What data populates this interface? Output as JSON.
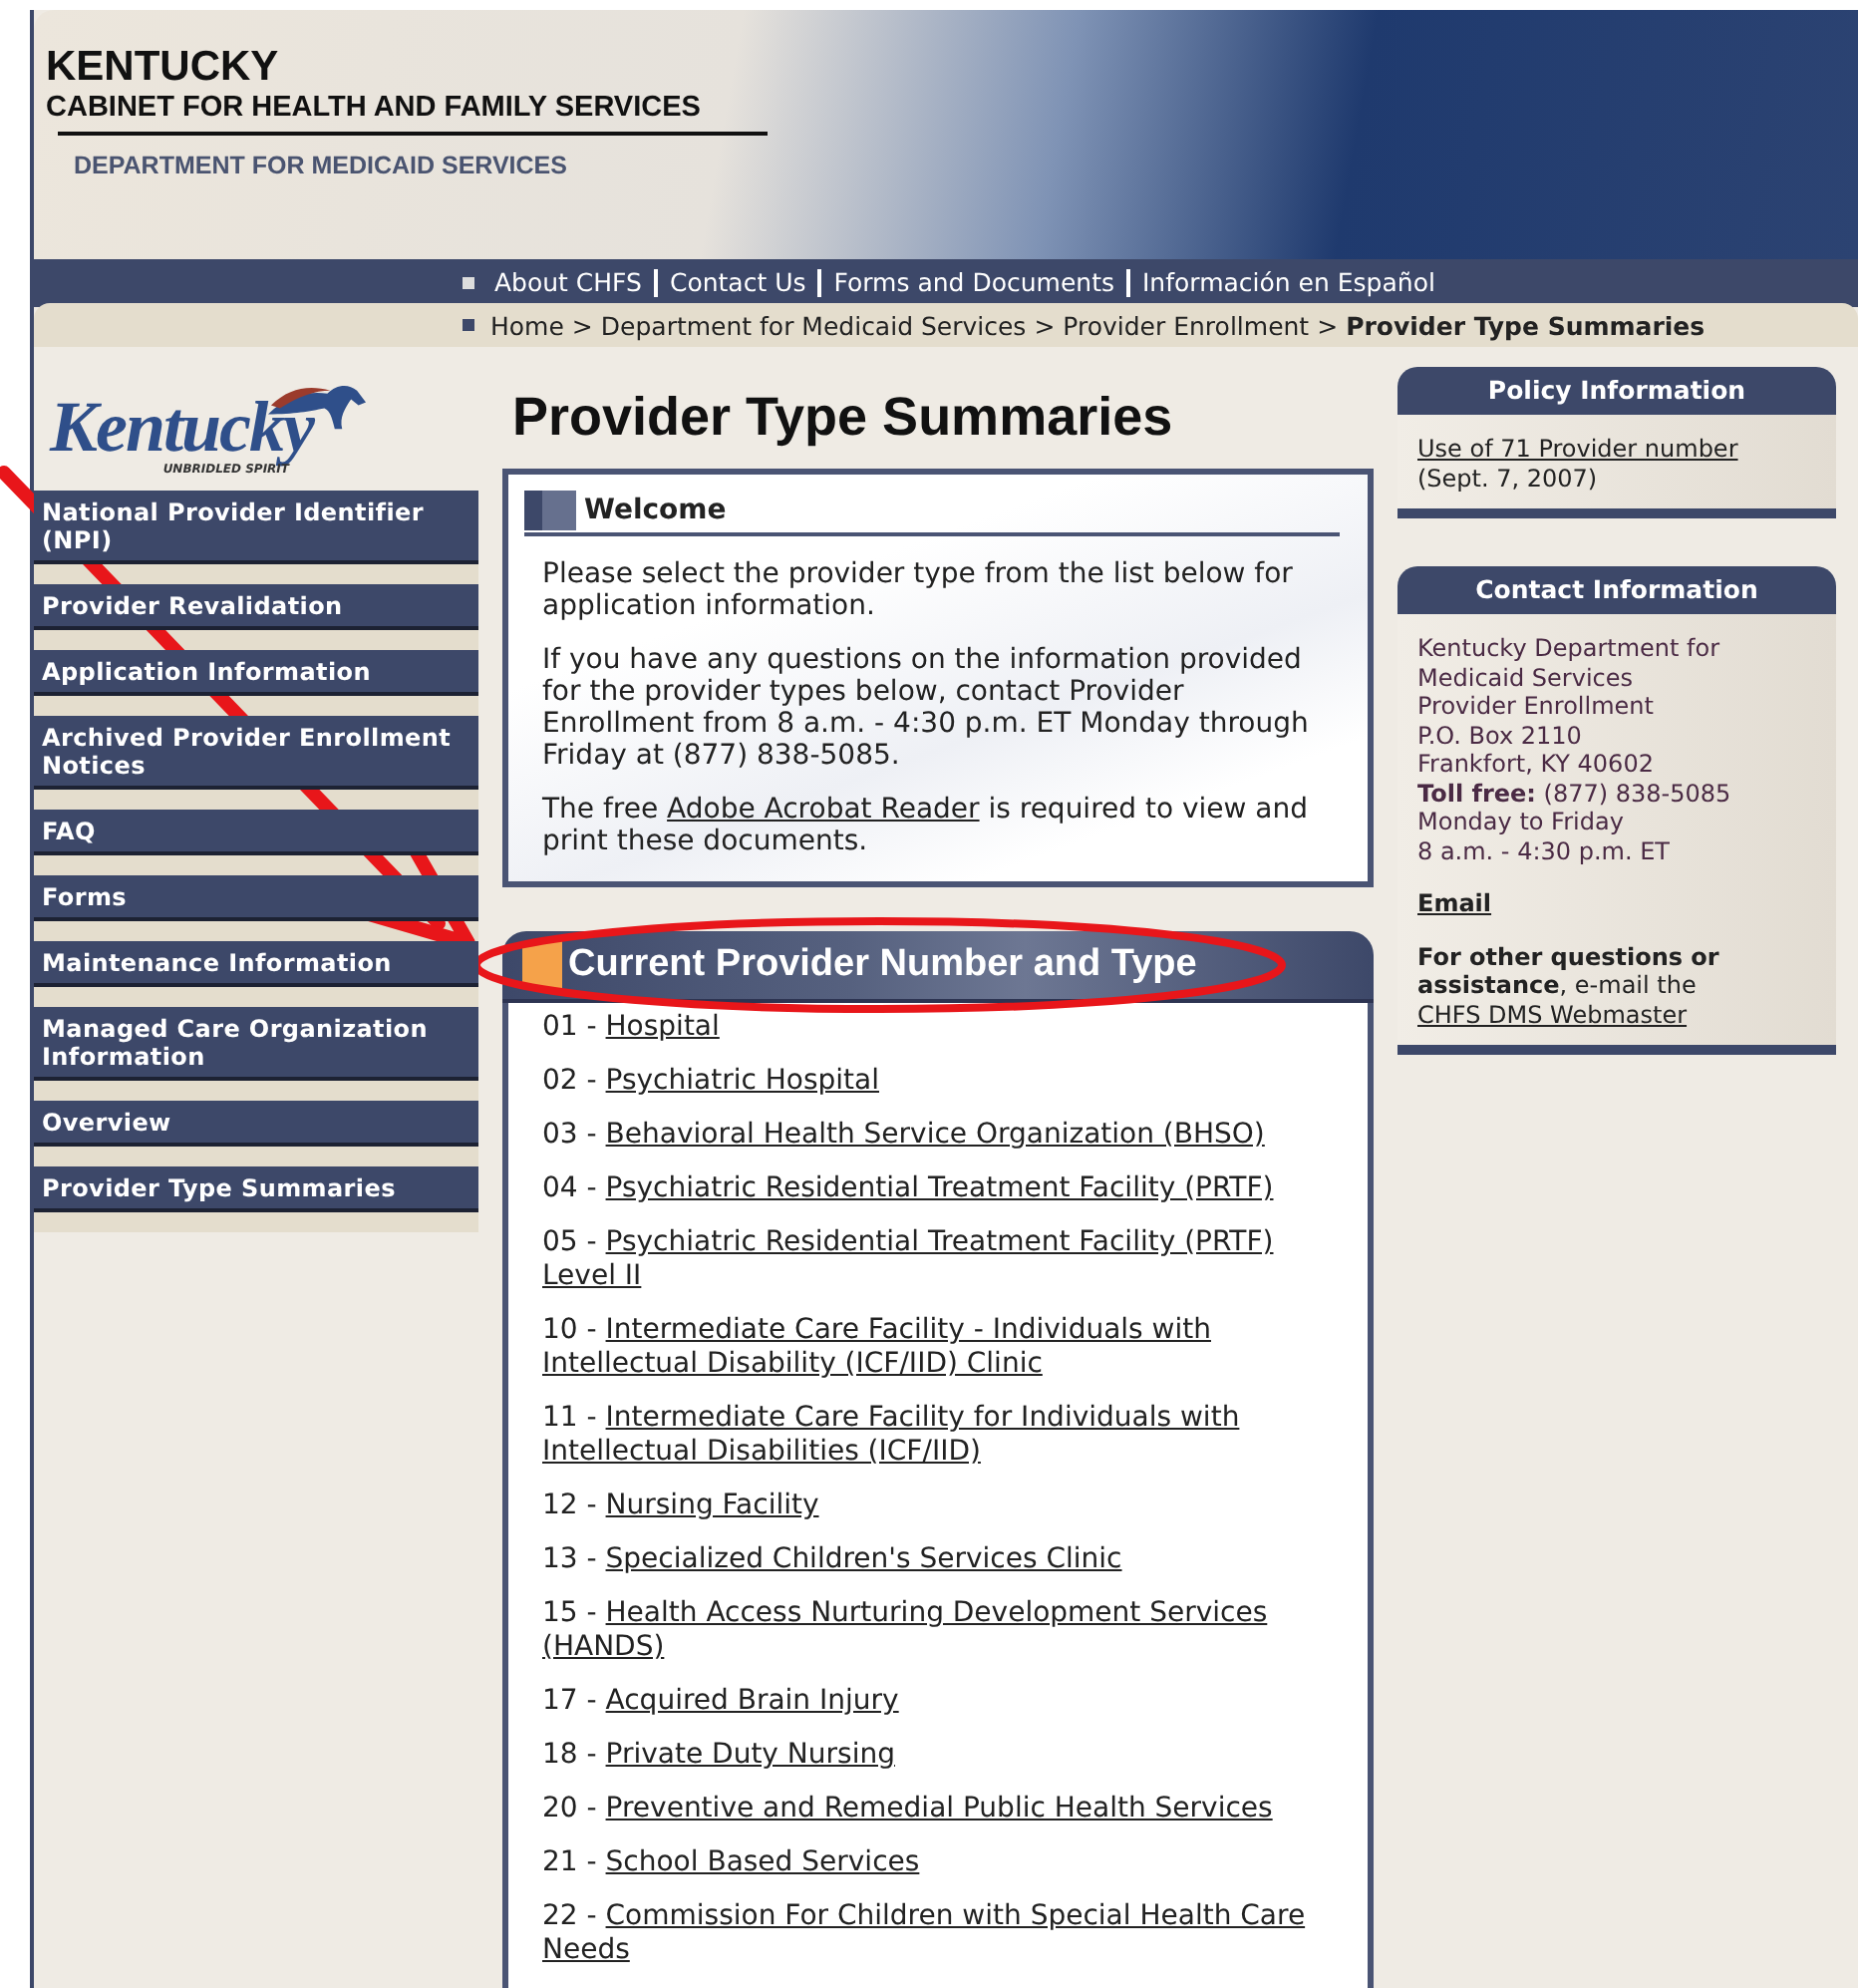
{
  "header": {
    "state": "KENTUCKY",
    "cabinet": "CABINET FOR HEALTH AND FAMILY SERVICES",
    "department": "DEPARTMENT FOR MEDICAID SERVICES"
  },
  "top_links": [
    "About CHFS",
    "Contact Us",
    "Forms and Documents",
    "Información en Español"
  ],
  "breadcrumb": [
    {
      "kind": "link",
      "text": "Home"
    },
    {
      "kind": "separator",
      "text": ">"
    },
    {
      "kind": "link",
      "text": "Department for Medicaid Services"
    },
    {
      "kind": "separator",
      "text": ">"
    },
    {
      "kind": "link",
      "text": "Provider Enrollment"
    },
    {
      "kind": "separator",
      "text": ">"
    },
    {
      "kind": "current",
      "text": "Provider Type Summaries"
    }
  ],
  "logo": {
    "wordmark": "Kentucky",
    "tagline": "UNBRIDLED SPIRIT"
  },
  "sidebar": {
    "items": [
      "National Provider Identifier (NPI)",
      "Provider Revalidation",
      "Application Information",
      "Archived Provider Enrollment Notices",
      "FAQ",
      "Forms",
      "Maintenance Information",
      "Managed Care Organization Information",
      "Overview",
      "Provider Type Summaries"
    ]
  },
  "page_title": "Provider Type Summaries",
  "welcome": {
    "title": "Welcome",
    "paragraphs": [
      [
        {
          "text": "Please select the provider type from the list below for application information."
        }
      ],
      [
        {
          "text": "If you have any questions on the information provided for the provider types below, contact Provider Enrollment from 8 a.m. - 4:30 p.m. ET Monday through Friday at (877) 838-5085."
        }
      ],
      [
        {
          "text": "The free "
        },
        {
          "link": "Adobe Acrobat Reader"
        },
        {
          "text": " is required to view and print these documents."
        }
      ]
    ]
  },
  "provider_list": {
    "title": "Current Provider Number and Type",
    "items": [
      {
        "number": "01 -",
        "label": "Hospital"
      },
      {
        "number": "02 -",
        "label": "Psychiatric Hospital"
      },
      {
        "number": "03 -",
        "label": "Behavioral Health Service Organization (BHSO)"
      },
      {
        "number": "04 -",
        "label": "Psychiatric Residential Treatment Facility (PRTF)"
      },
      {
        "number": "05 -",
        "label": "Psychiatric Residential Treatment Facility (PRTF) Level II"
      },
      {
        "number": "10 -",
        "label": "Intermediate Care Facility - Individuals with Intellectual Disability (ICF/IID) Clinic"
      },
      {
        "number": "11 -",
        "label": "Intermediate Care Facility for Individuals with Intellectual Disabilities (ICF/IID)"
      },
      {
        "number": "12 -",
        "label": "Nursing Facility"
      },
      {
        "number": "13 -",
        "label": "Specialized Children's Services Clinic"
      },
      {
        "number": "15 -",
        "label": "Health Access Nurturing Development Services (HANDS)"
      },
      {
        "number": "17 -",
        "label": "Acquired Brain Injury"
      },
      {
        "number": "18 -",
        "label": "Private Duty Nursing"
      },
      {
        "number": "20 -",
        "label": "Preventive and Remedial Public Health Services"
      },
      {
        "number": "21 -",
        "label": "School Based Services"
      },
      {
        "number": "22 -",
        "label": "Commission For Children with Special Health Care Needs"
      }
    ]
  },
  "policy": {
    "title": "Policy Information",
    "link": "Use of 71 Provider number",
    "date": "(Sept. 7, 2007)"
  },
  "contact": {
    "title": "Contact Information",
    "lines": [
      "Kentucky Department for",
      "Medicaid Services",
      "Provider Enrollment",
      "P.O. Box 2110",
      "Frankfort, KY 40602",
      "**Toll free:** (877) 838-5085",
      "Monday to Friday",
      "8 a.m. - 4:30 p.m. ET"
    ],
    "email": "Email",
    "other": "**For other questions or assistance**, e-mail the ",
    "webmaster": "CHFS DMS Webmaster"
  }
}
